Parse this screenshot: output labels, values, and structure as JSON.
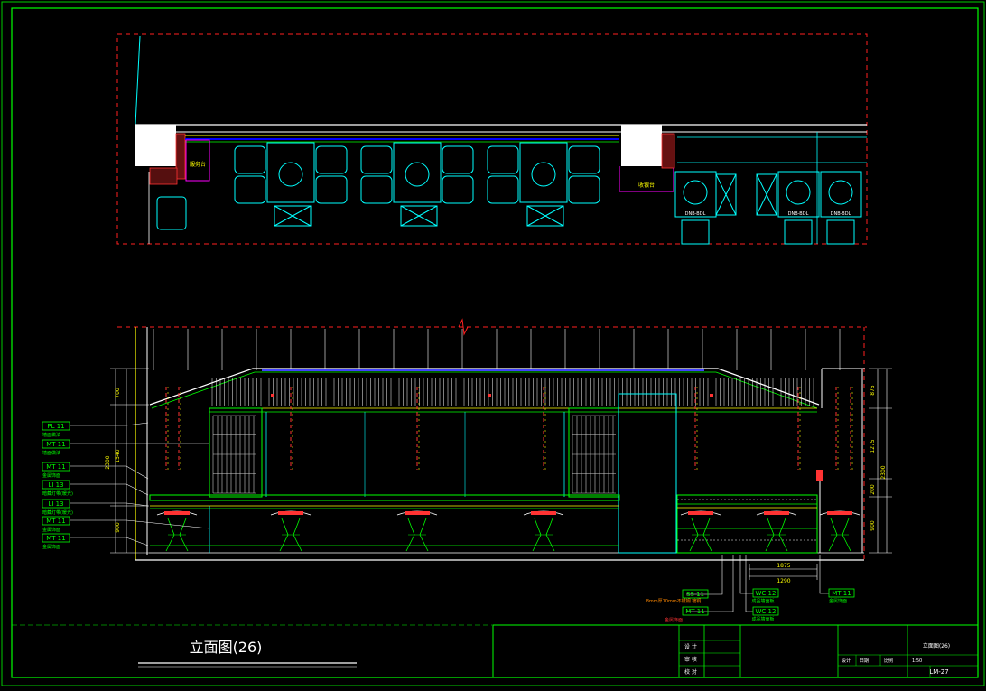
{
  "drawing": {
    "title": "立面图(26)",
    "sheet_name": "立面图(26)",
    "sheet_number": "LM-27"
  },
  "tags": [
    {
      "code": "PL 11",
      "note": "墙面做法"
    },
    {
      "code": "MT 11",
      "note": "墙面做法"
    },
    {
      "code": "MT 11",
      "note": "金属饰面"
    },
    {
      "code": "LI 13",
      "note": "暗藏灯带(暖光)"
    },
    {
      "code": "LI 13",
      "note": "暗藏灯带(暖光)"
    },
    {
      "code": "MT 11",
      "note": "金属饰面"
    },
    {
      "code": "MT 11",
      "note": "金属饰面"
    }
  ],
  "bottom_tags": [
    {
      "code": "SS 11",
      "note": "8mm厚10mm不锈钢  镀铜"
    },
    {
      "code": "MT 11",
      "note": "金属饰面"
    },
    {
      "code": "WC 12",
      "note": "成品墙面板"
    },
    {
      "code": "WC 12",
      "note": "成品墙面板"
    },
    {
      "code": "MT 11",
      "note": "金属饰面"
    }
  ],
  "plan_labels": {
    "counter_a": "服务台",
    "counter_b": "收银台",
    "seat": "DNB-BDL"
  },
  "dims_left": [
    "700",
    "1540",
    "2300",
    "900"
  ],
  "dims_right": [
    "875",
    "1275",
    "200",
    "2300",
    "900"
  ],
  "dims_bottom": [
    "1875",
    "1290"
  ],
  "title_block": {
    "row1": "设 计",
    "row2": "审 核",
    "row3": "校 对",
    "design": "设计",
    "date": "日期",
    "scale": "比例",
    "scale_val": "1:50"
  },
  "colors": {
    "frame": "#00ff00",
    "wall": "#ffffff",
    "furniture": "#00ffff",
    "accent": "#ff0000",
    "glass": "#0000ff",
    "detail": "#ffff00",
    "magenta": "#ff00ff"
  }
}
